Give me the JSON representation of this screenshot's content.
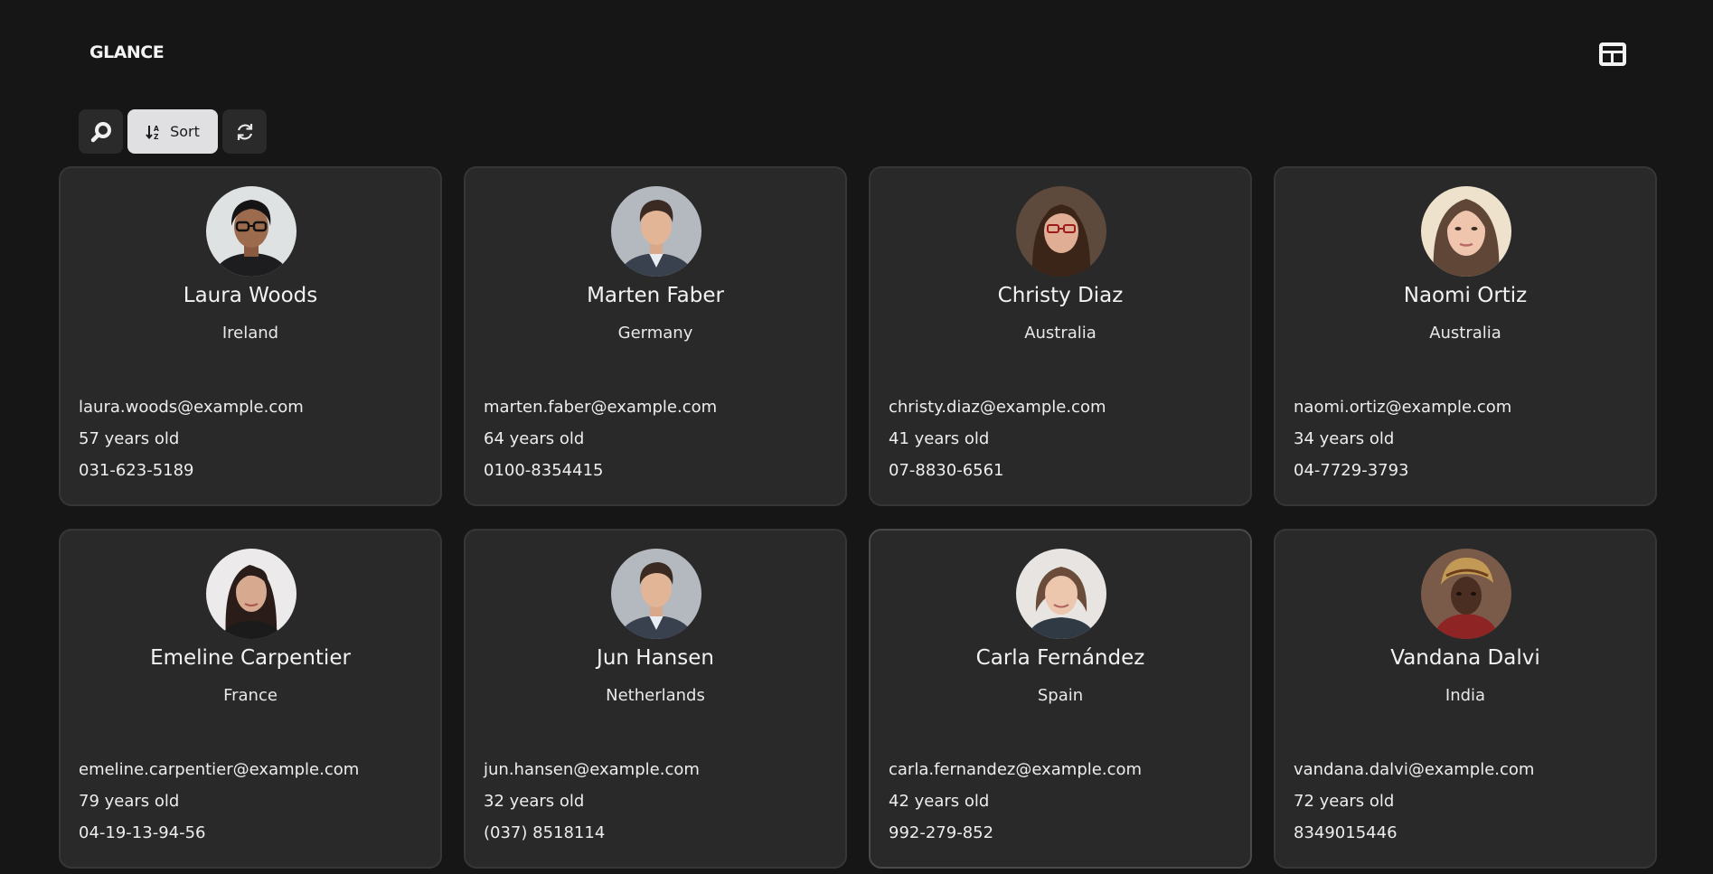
{
  "app": {
    "brand": "GLANCE"
  },
  "header": {
    "layout_toggle_icon": "grid-layout-icon"
  },
  "toolbar": {
    "search_icon": "search-icon",
    "sort_label": "Sort",
    "sort_icon": "sort-icon",
    "refresh_icon": "refresh-icon"
  },
  "colors": {
    "background": "#161616",
    "card": "#292929",
    "sort_button": "#e0e0e2"
  },
  "people": [
    {
      "name": "Laura Woods",
      "country": "Ireland",
      "email": "laura.woods@example.com",
      "age": "57 years old",
      "phone": "031-623-5189"
    },
    {
      "name": "Marten Faber",
      "country": "Germany",
      "email": "marten.faber@example.com",
      "age": "64 years old",
      "phone": "0100-8354415"
    },
    {
      "name": "Christy Diaz",
      "country": "Australia",
      "email": "christy.diaz@example.com",
      "age": "41 years old",
      "phone": "07-8830-6561"
    },
    {
      "name": "Naomi Ortiz",
      "country": "Australia",
      "email": "naomi.ortiz@example.com",
      "age": "34 years old",
      "phone": "04-7729-3793"
    },
    {
      "name": "Emeline Carpentier",
      "country": "France",
      "email": "emeline.carpentier@example.com",
      "age": "79 years old",
      "phone": "04-19-13-94-56"
    },
    {
      "name": "Jun Hansen",
      "country": "Netherlands",
      "email": "jun.hansen@example.com",
      "age": "32 years old",
      "phone": "(037) 8518114"
    },
    {
      "name": "Carla Fernández",
      "country": "Spain",
      "email": "carla.fernandez@example.com",
      "age": "42 years old",
      "phone": "992-279-852"
    },
    {
      "name": "Vandana Dalvi",
      "country": "India",
      "email": "vandana.dalvi@example.com",
      "age": "72 years old",
      "phone": "8349015446"
    }
  ]
}
